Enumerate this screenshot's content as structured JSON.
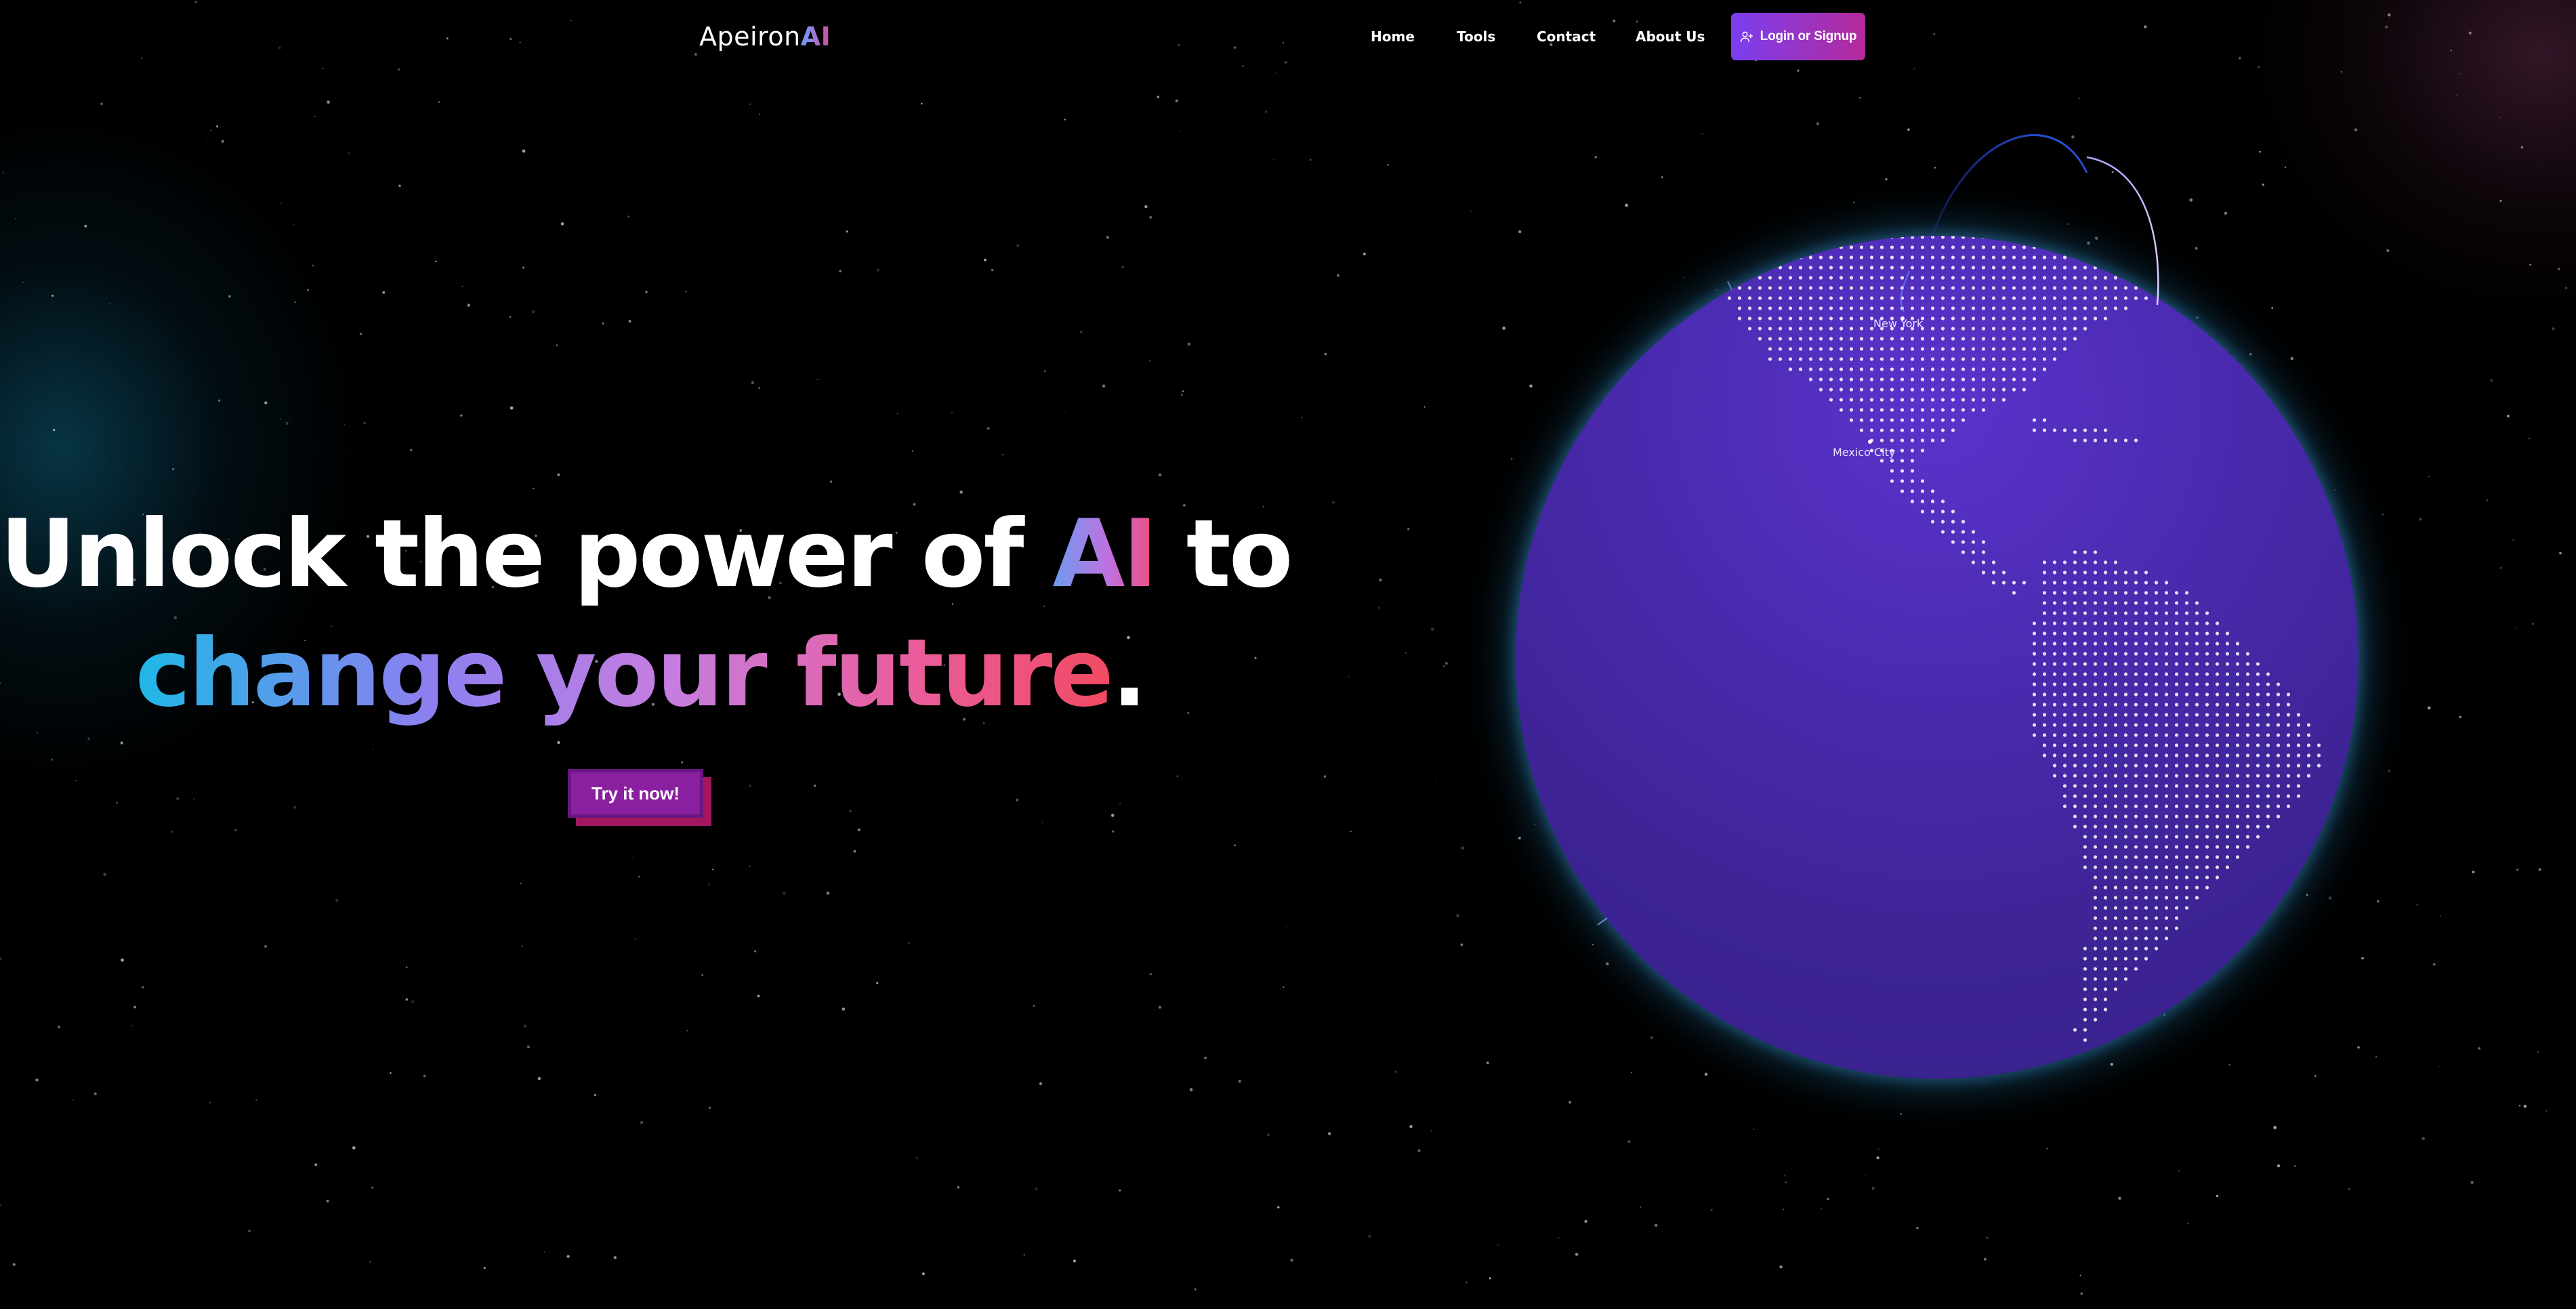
{
  "nav": {
    "logo_main": "Apeiron",
    "logo_accent": "AI",
    "links": [
      {
        "label": "Home"
      },
      {
        "label": "Tools"
      },
      {
        "label": "Contact"
      },
      {
        "label": "About Us"
      }
    ],
    "login_label": "Login or Signup"
  },
  "hero": {
    "line1_a": "Unlock the power of ",
    "line1_ai": "AI",
    "line1_b": " to",
    "line2_grad": "change your future",
    "line2_end": ".",
    "cta_label": "Try it now!"
  },
  "globe": {
    "cities": [
      "New York",
      "Mexico City"
    ]
  },
  "colors": {
    "background": "#000000",
    "globe": "#4a2bb0",
    "login_start": "#7a3ef0",
    "login_end": "#b42a9a",
    "cta": "#8a1fa0"
  },
  "icons": {
    "login": "user-plus-icon"
  }
}
